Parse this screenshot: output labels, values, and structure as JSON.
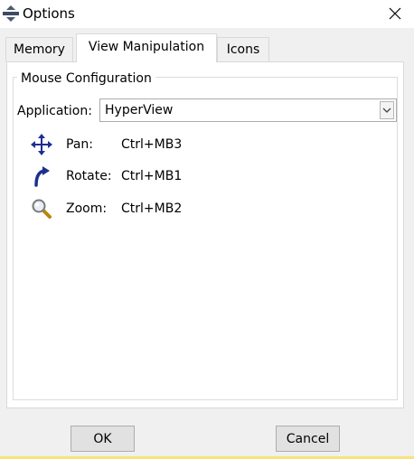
{
  "window": {
    "title": "Options",
    "icon": "options-icon"
  },
  "tabs": [
    {
      "label": "Memory",
      "active": false
    },
    {
      "label": "View Manipulation",
      "active": true
    },
    {
      "label": "Icons",
      "active": false
    }
  ],
  "group": {
    "title": "Mouse Configuration"
  },
  "application": {
    "label": "Application:",
    "selected": "HyperView"
  },
  "mappings": [
    {
      "icon": "pan-arrows-icon",
      "label": "Pan:",
      "binding": "Ctrl+MB3"
    },
    {
      "icon": "rotate-arrow-icon",
      "label": "Rotate:",
      "binding": "Ctrl+MB1"
    },
    {
      "icon": "zoom-magnifier-icon",
      "label": "Zoom:",
      "binding": "Ctrl+MB2"
    }
  ],
  "buttons": {
    "ok": "OK",
    "cancel": "Cancel"
  },
  "colors": {
    "panel_bg": "#f0f0f0",
    "icon_blue": "#1e2f8f",
    "accent_bar": "#f7e37c"
  }
}
